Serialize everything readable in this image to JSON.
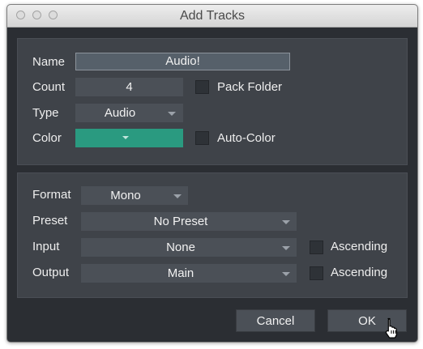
{
  "window": {
    "title": "Add Tracks"
  },
  "track": {
    "name_label": "Name",
    "name_value": "Audio!",
    "count_label": "Count",
    "count_value": "4",
    "pack_folder_label": "Pack Folder",
    "type_label": "Type",
    "type_value": "Audio",
    "color_label": "Color",
    "color_value": "#2a9a80",
    "auto_color_label": "Auto-Color"
  },
  "io": {
    "format_label": "Format",
    "format_value": "Mono",
    "preset_label": "Preset",
    "preset_value": "No Preset",
    "input_label": "Input",
    "input_value": "None",
    "input_ascending_label": "Ascending",
    "output_label": "Output",
    "output_value": "Main",
    "output_ascending_label": "Ascending"
  },
  "buttons": {
    "cancel": "Cancel",
    "ok": "OK"
  }
}
